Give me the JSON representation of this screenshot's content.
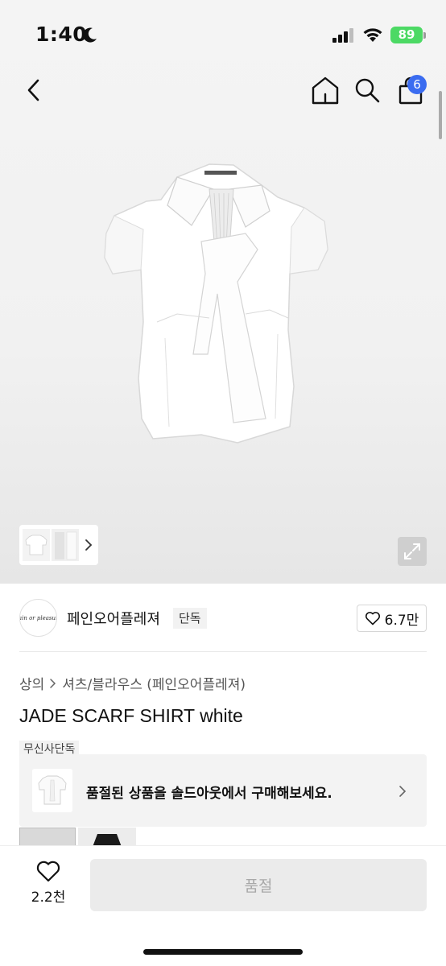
{
  "status_bar": {
    "time": "1:40",
    "battery": "89"
  },
  "nav": {
    "cart_count": "6"
  },
  "gallery": {
    "thumbnail_count_hint": "2"
  },
  "brand": {
    "logo_text": "Pain or pleasure",
    "name": "페인오어플레져",
    "tag": "단독",
    "likes": "6.7만"
  },
  "product": {
    "category_1": "상의",
    "category_2": "셔츠/블라우스 (페인오어플레져)",
    "title": "JADE SCARF SHIRT white",
    "exclusive_tag": "무신사단독"
  },
  "soldout_banner": {
    "text": "품절된 상품을 솔드아웃에서 구매해보세요."
  },
  "bottom_bar": {
    "like_count": "2.2천",
    "buy_label": "품절"
  },
  "colors": {
    "badge": "#3b6cf0",
    "battery": "#4cd964",
    "disabled_button": "#ebebeb"
  }
}
